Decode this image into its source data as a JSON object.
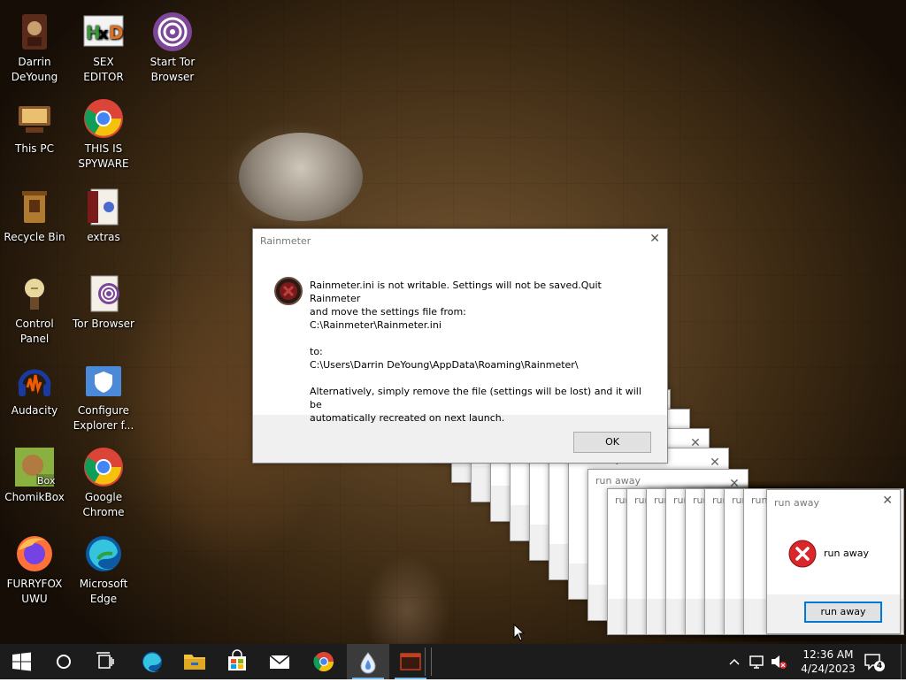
{
  "desktop_icons": [
    {
      "label_line1": "Darrin",
      "label_line2": "DeYoung",
      "icon": "user-folder-icon"
    },
    {
      "label_line1": "SEX",
      "label_line2": "EDITOR",
      "icon": "hxd-editor-icon"
    },
    {
      "label_line1": "Start Tor",
      "label_line2": "Browser",
      "icon": "tor-browser-icon"
    },
    {
      "label_line1": "This PC",
      "label_line2": "",
      "icon": "this-pc-icon"
    },
    {
      "label_line1": "THIS IS",
      "label_line2": "SPYWARE",
      "icon": "chrome-icon"
    },
    {
      "label_line1": "Recycle Bin",
      "label_line2": "",
      "icon": "recycle-bin-icon"
    },
    {
      "label_line1": "extras",
      "label_line2": "",
      "icon": "extras-folder-icon"
    },
    {
      "label_line1": "Control Panel",
      "label_line2": "",
      "icon": "control-panel-icon"
    },
    {
      "label_line1": "Tor Browser",
      "label_line2": "",
      "icon": "tor-browser-icon"
    },
    {
      "label_line1": "Audacity",
      "label_line2": "",
      "icon": "audacity-icon"
    },
    {
      "label_line1": "Configure",
      "label_line2": "Explorer f...",
      "icon": "shield-icon"
    },
    {
      "label_line1": "ChomikBox",
      "label_line2": "",
      "icon": "chomikbox-icon"
    },
    {
      "label_line1": "Google",
      "label_line2": "Chrome",
      "icon": "chrome-icon"
    },
    {
      "label_line1": "FURRYFOX",
      "label_line2": "UWU",
      "icon": "firefox-icon"
    },
    {
      "label_line1": "Microsoft",
      "label_line2": "Edge",
      "icon": "edge-icon"
    }
  ],
  "rainmeter_dialog": {
    "title": "Rainmeter",
    "close_glyph": "✕",
    "line1": "Rainmeter.ini is not writable. Settings will not be saved.Quit Rainmeter",
    "line2": "and move the settings file from:",
    "line3": "C:\\Rainmeter\\Rainmeter.ini",
    "line4": "to:",
    "line5": "C:\\Users\\Darrin DeYoung\\AppData\\Roaming\\Rainmeter\\",
    "line6": "Alternatively, simply remove the file (settings will be lost) and it will be",
    "line7": "automatically recreated on next launch.",
    "ok_label": "OK",
    "icon": "error-icon"
  },
  "run_away_windows": {
    "title": "run away",
    "partial_title": "run",
    "partial_title2": "run away",
    "message": "run away",
    "button_label": "run away",
    "close_glyph": "✕"
  },
  "taskbar": {
    "start_icon": "windows-start-icon",
    "search_icon": "cortana-circle-icon",
    "task_view_icon": "task-view-icon",
    "pinned": [
      "edge-icon",
      "file-explorer-icon",
      "store-icon",
      "mail-icon",
      "chrome-icon",
      "rainmeter-icon",
      "app-window-icon"
    ],
    "clock_time": "12:36 AM",
    "clock_date": "4/24/2023",
    "notification_count": "4"
  },
  "colors": {
    "taskbar_bg": "#1c1c1c",
    "accent": "#0078d7",
    "error_red": "#d9262b"
  }
}
